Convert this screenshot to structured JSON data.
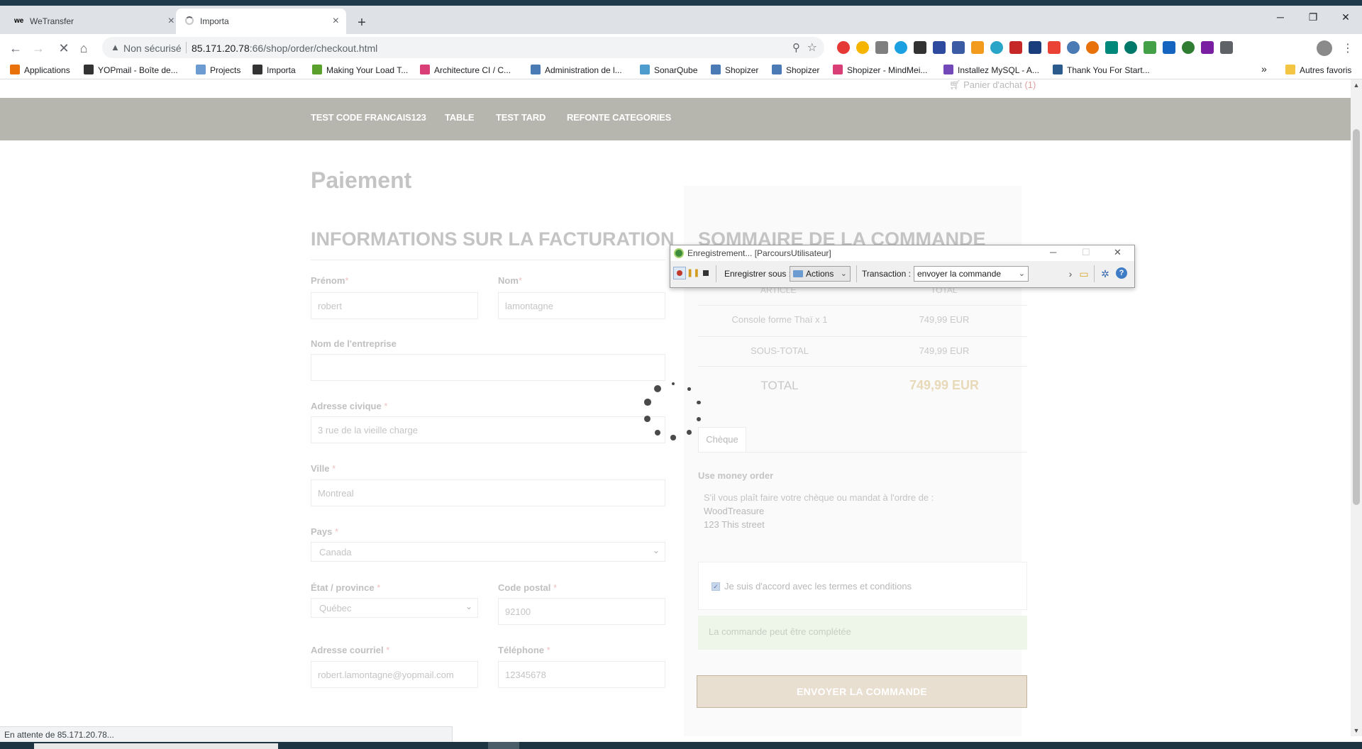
{
  "browser": {
    "tabs": [
      {
        "title": "WeTransfer",
        "favicon": "wetransfer-logo"
      },
      {
        "title": "Importa",
        "favicon": "loading-spinner"
      }
    ],
    "address": {
      "security_label": "Non sécurisé",
      "host": "85.171.20.78",
      "path": ":66/shop/order/checkout.html"
    },
    "bookmarks": [
      {
        "label": "Applications",
        "icon_color": "#e8710a"
      },
      {
        "label": "YOPmail - Boîte de...",
        "icon_color": "#333333"
      },
      {
        "label": "Projects",
        "icon_color": "#6c9bd2"
      },
      {
        "label": "Importa",
        "icon_color": "#333333"
      },
      {
        "label": "Making Your Load T...",
        "icon_color": "#5aa02c"
      },
      {
        "label": "Architecture CI / C...",
        "icon_color": "#d93f76"
      },
      {
        "label": "Administration de l...",
        "icon_color": "#4a7bb5"
      },
      {
        "label": "SonarQube",
        "icon_color": "#4e9bcd"
      },
      {
        "label": "Shopizer",
        "icon_color": "#4a7bb5"
      },
      {
        "label": "Shopizer",
        "icon_color": "#4a7bb5"
      },
      {
        "label": "Shopizer - MindMei...",
        "icon_color": "#d93f76"
      },
      {
        "label": "Installez MySQL - A...",
        "icon_color": "#7248b9"
      },
      {
        "label": "Thank You For Start...",
        "icon_color": "#2a5b8c"
      }
    ],
    "bookmarks_overflow": "»",
    "other_bookmarks": "Autres favoris",
    "status_text": "En attente de 85.171.20.78..."
  },
  "shop": {
    "cart": {
      "label": "Panier d'achat",
      "count": "(1)"
    },
    "nav": [
      "TEST CODE FRANCAIS123",
      "TABLE",
      "TEST TARD",
      "REFONTE CATEGORIES"
    ],
    "page_title": "Paiement",
    "billing": {
      "title": "INFORMATIONS SUR LA FACTURATION",
      "first_name": {
        "label": "Prénom",
        "value": "robert"
      },
      "last_name": {
        "label": "Nom",
        "value": "lamontagne"
      },
      "company": {
        "label": "Nom de l'entreprise",
        "value": ""
      },
      "street": {
        "label": "Adresse civique",
        "value": "3 rue de la vieille charge"
      },
      "city": {
        "label": "Ville",
        "value": "Montreal"
      },
      "country": {
        "label": "Pays",
        "value": "Canada"
      },
      "state": {
        "label": "État / province",
        "value": "Québec"
      },
      "postal": {
        "label": "Code postal",
        "value": "92100"
      },
      "email": {
        "label": "Adresse courriel",
        "value": "robert.lamontagne@yopmail.com"
      },
      "phone": {
        "label": "Téléphone",
        "value": "12345678"
      }
    },
    "summary": {
      "title": "SOMMAIRE DE LA COMMANDE",
      "col_article": "ARTICLE",
      "col_total": "TOTAL",
      "item_name": "Console forme Thaï",
      "item_qty": "x 1",
      "item_price": "749,99 EUR",
      "subtotal_label": "SOUS-TOTAL",
      "subtotal_value": "749,99 EUR",
      "total_label": "TOTAL",
      "total_value": "749,99 EUR"
    },
    "payment": {
      "tab": "Chèque",
      "method": "Use money order",
      "instructions": "S'il vous plaît faire votre chèque ou mandat à l'ordre de :",
      "payee": "WoodTreasure",
      "address": "123 This street"
    },
    "terms_label": "Je suis d'accord avec les termes et conditions",
    "status_message": "La commande peut être complétée",
    "submit_label": "ENVOYER LA COMMANDE"
  },
  "recorder": {
    "title": "Enregistrement... [ParcoursUtilisateur]",
    "save_as_label": "Enregistrer sous :",
    "save_as_value": "Actions",
    "transaction_label": "Transaction :",
    "transaction_value": "envoyer la commande"
  },
  "colors": {
    "nav_band": "#b6b5ae",
    "submit_bg": "#e9dfd1",
    "total_accent": "#e8d9b8",
    "success_bg": "#eef6ea"
  }
}
